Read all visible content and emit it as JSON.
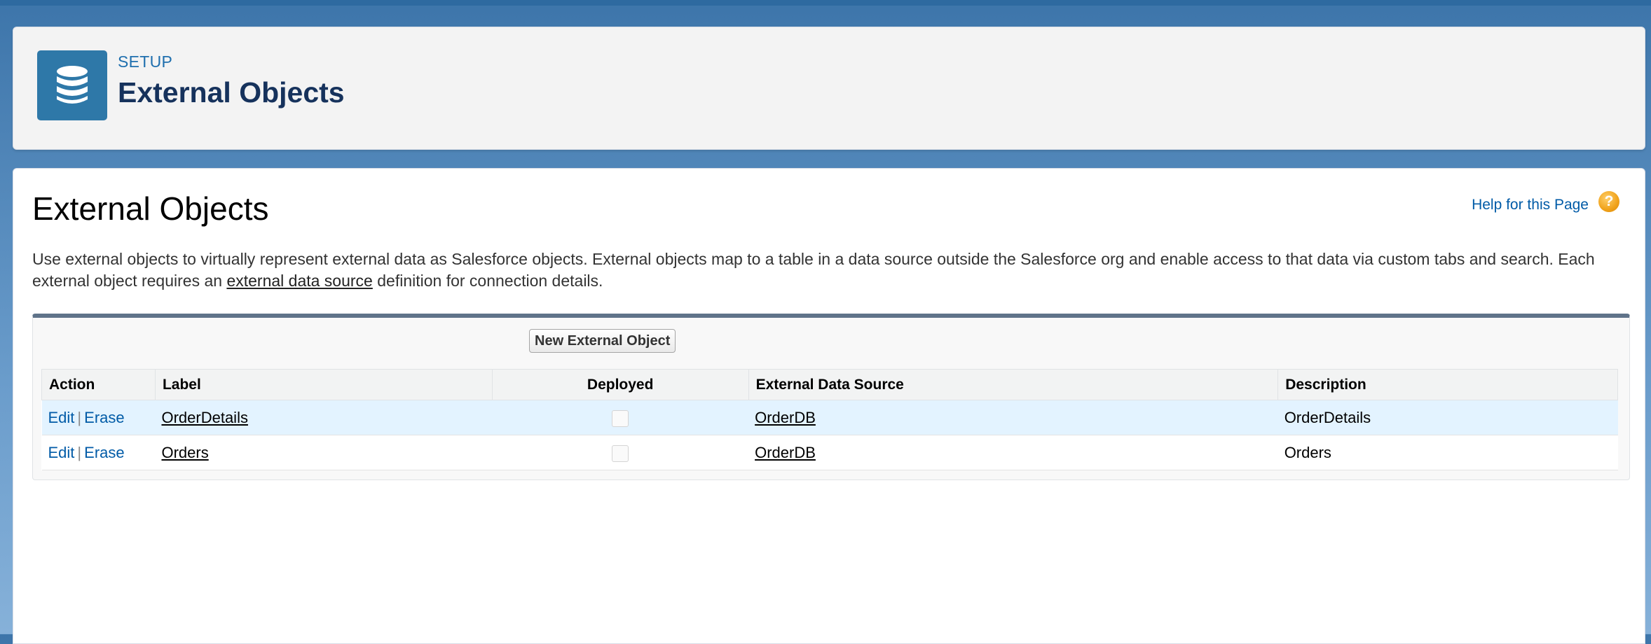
{
  "header": {
    "section": "SETUP",
    "title": "External Objects",
    "icon": "database-icon"
  },
  "page": {
    "title": "External Objects",
    "help_link": "Help for this Page",
    "help_icon": "?",
    "description_part1": "Use external objects to virtually represent external data as Salesforce objects. External objects map to a table in a data source outside the Salesforce org and enable access to that data via custom tabs and search. Each external object requires an ",
    "description_link": "external data source",
    "description_part2": " definition for connection details."
  },
  "list": {
    "new_button": "New External Object",
    "columns": {
      "action": "Action",
      "label": "Label",
      "deployed": "Deployed",
      "source": "External Data Source",
      "description": "Description"
    },
    "action_edit": "Edit",
    "action_separator": "|",
    "action_erase": "Erase",
    "rows": [
      {
        "label": "OrderDetails",
        "deployed": false,
        "source": "OrderDB",
        "description": "OrderDetails"
      },
      {
        "label": "Orders",
        "deployed": false,
        "source": "OrderDB",
        "description": "Orders"
      }
    ]
  },
  "colors": {
    "brand_blue": "#2e78a8",
    "link_blue": "#015ba7",
    "highlight_row": "#e3f3ff"
  }
}
